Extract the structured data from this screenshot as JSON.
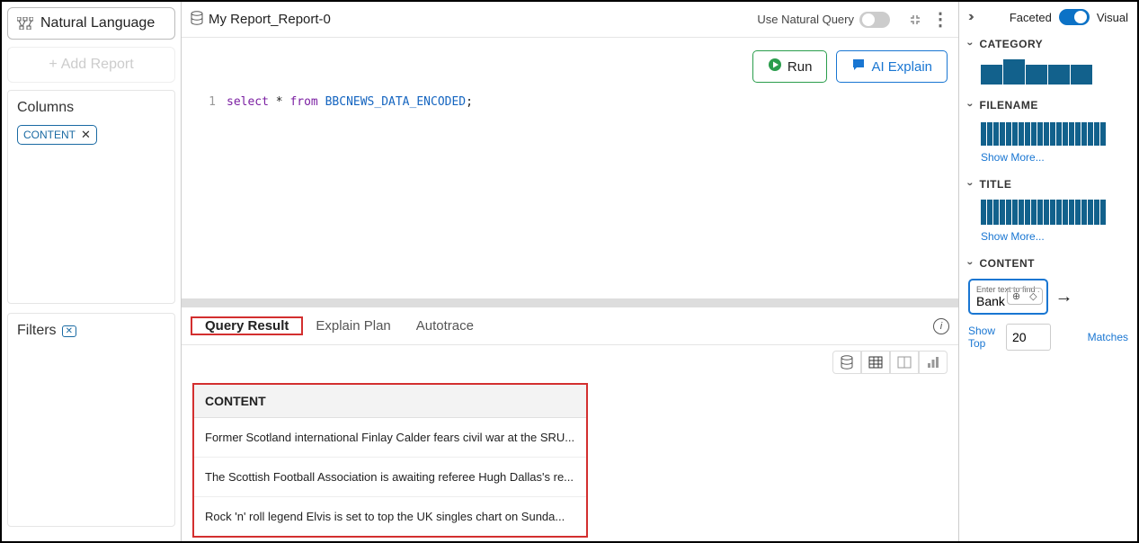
{
  "sidebar": {
    "natural_language": "Natural Language",
    "add_report": "Add Report",
    "columns_title": "Columns",
    "column_chip": "CONTENT",
    "filters_title": "Filters"
  },
  "main": {
    "title": "My Report_Report-0",
    "use_nq_label": "Use Natural Query",
    "run_label": "Run",
    "ai_label": "AI Explain",
    "line_no": "1",
    "sql_kw1": "select",
    "sql_star": " * ",
    "sql_kw2": "from",
    "sql_ident": " BBCNEWS_DATA_ENCODED",
    "sql_end": ";"
  },
  "tabs": {
    "query_result": "Query Result",
    "explain_plan": "Explain Plan",
    "autotrace": "Autotrace"
  },
  "results": {
    "header": "CONTENT",
    "rows": [
      "Former Scotland international Finlay Calder fears civil war at the SRU...",
      "The Scottish Football Association is awaiting referee Hugh Dallas's re...",
      "Rock 'n' roll legend Elvis is set to top the UK singles chart on Sunda..."
    ]
  },
  "right": {
    "faceted": "Faceted",
    "visual": "Visual",
    "facets": {
      "category": "CATEGORY",
      "filename": "FILENAME",
      "title": "TITLE",
      "content": "CONTENT"
    },
    "show_more": "Show More...",
    "search_label": "Enter text to find :",
    "search_value": "Bank",
    "show_top": "Show Top",
    "top_value": "20",
    "matches": "Matches"
  },
  "chart_data": [
    {
      "type": "bar",
      "facet": "CATEGORY",
      "values": [
        22,
        28,
        22,
        22,
        22
      ]
    },
    {
      "type": "bar",
      "facet": "FILENAME",
      "values": [
        26,
        26,
        26,
        26,
        26,
        26,
        26,
        26,
        26,
        26,
        26,
        26,
        26,
        26,
        26,
        26,
        26,
        26,
        26,
        26
      ]
    },
    {
      "type": "bar",
      "facet": "TITLE",
      "values": [
        28,
        28,
        28,
        28,
        28,
        28,
        28,
        28,
        28,
        28,
        28,
        28,
        28,
        28,
        28,
        28,
        28,
        28,
        28,
        28
      ]
    }
  ]
}
